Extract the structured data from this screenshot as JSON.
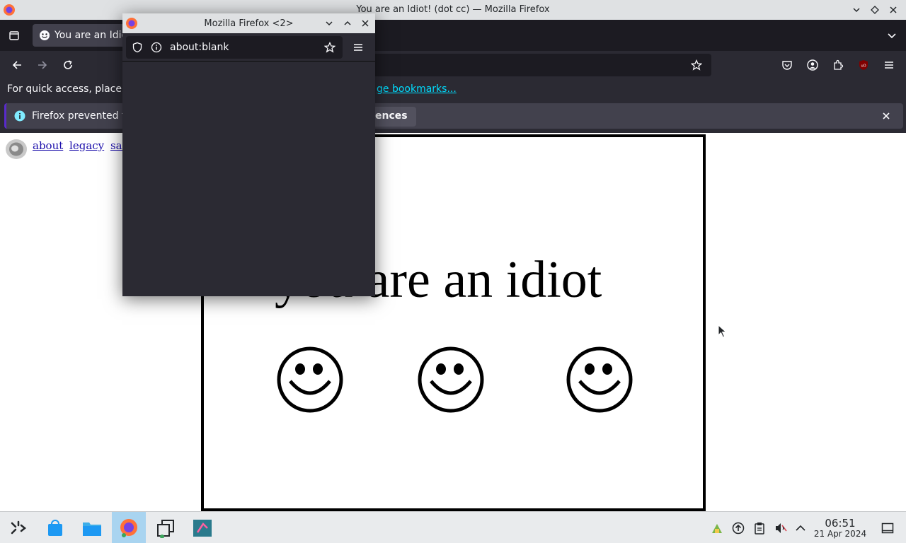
{
  "window": {
    "title": "You are an Idiot! (dot cc) — Mozilla Firefox"
  },
  "tabs": [
    {
      "label": "You are an Idio"
    }
  ],
  "bookmarks_bar": {
    "text": "For quick access, place y",
    "link": "ge bookmarks..."
  },
  "notification": {
    "text": "Firefox prevented t",
    "button": "ences"
  },
  "page": {
    "links": [
      "about",
      "legacy",
      "safe"
    ],
    "headline": "you are an idiot",
    "smileys": 3
  },
  "popup": {
    "title": "Mozilla Firefox <2>",
    "url": "about:blank"
  },
  "taskbar": {
    "time": "06:51",
    "date": "21 Apr 2024"
  },
  "colors": {
    "toolbar": "#2b2a33",
    "tabstrip": "#1c1b22",
    "link": "#00ddff",
    "taskbar": "#e9ebed"
  }
}
